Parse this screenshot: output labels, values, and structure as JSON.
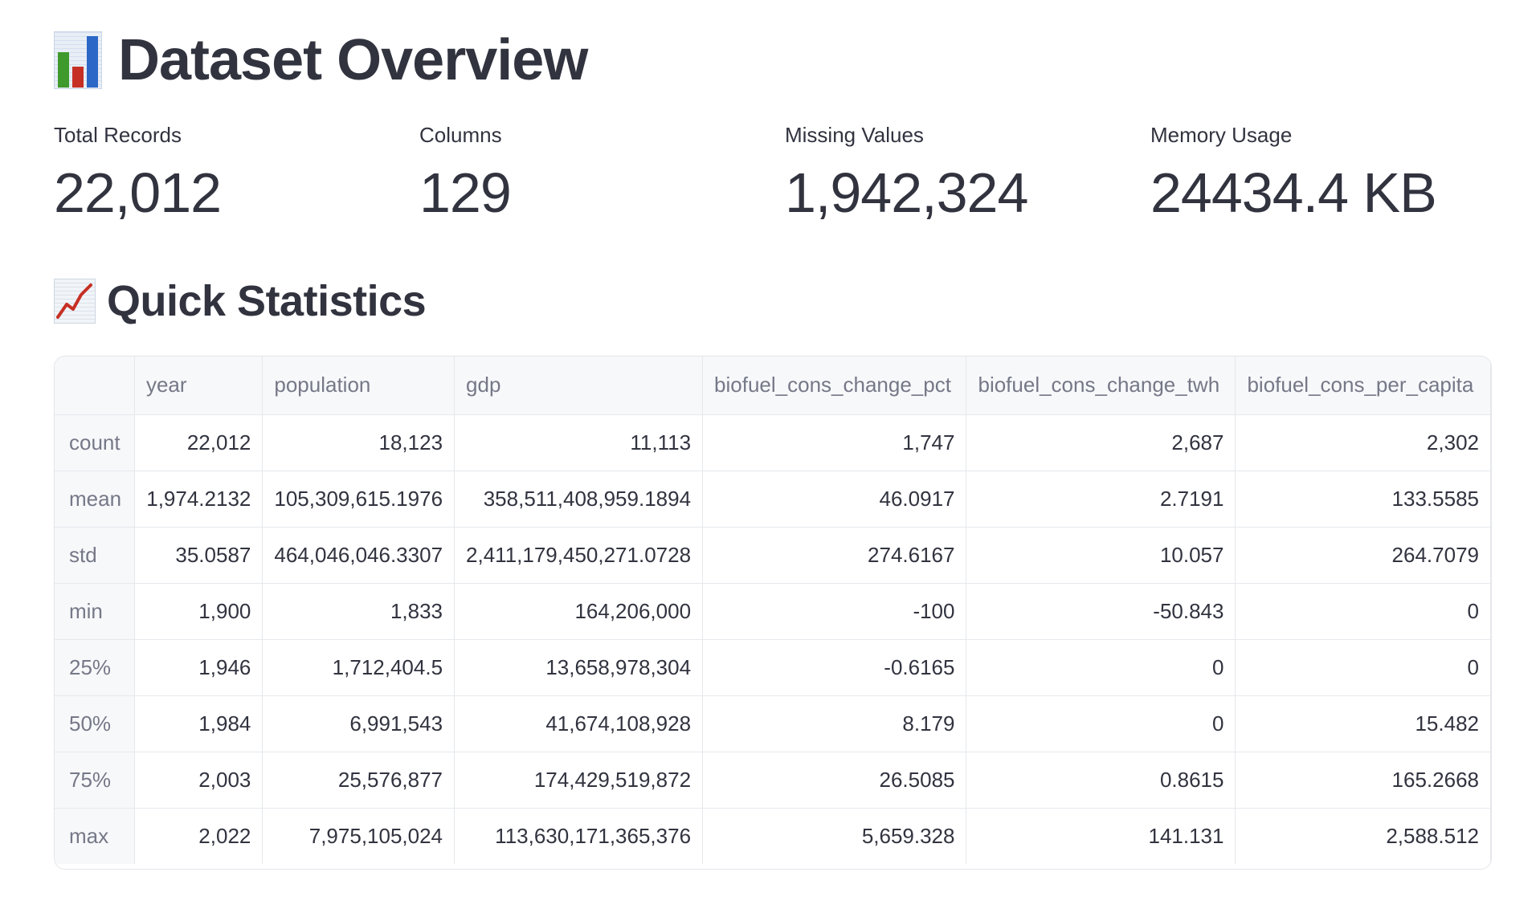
{
  "overview": {
    "icon": "bar-chart-icon",
    "title": "Dataset Overview"
  },
  "metrics": [
    {
      "label": "Total Records",
      "value": "22,012"
    },
    {
      "label": "Columns",
      "value": "129"
    },
    {
      "label": "Missing Values",
      "value": "1,942,324"
    },
    {
      "label": "Memory Usage",
      "value": "24434.4 KB"
    }
  ],
  "stats": {
    "icon": "line-chart-icon",
    "title": "Quick Statistics",
    "columns": [
      "",
      "year",
      "population",
      "gdp",
      "biofuel_cons_change_pct",
      "biofuel_cons_change_twh",
      "biofuel_cons_per_capita"
    ],
    "rows": [
      {
        "label": "count",
        "values": [
          "22,012",
          "18,123",
          "11,113",
          "1,747",
          "2,687",
          "2,302"
        ]
      },
      {
        "label": "mean",
        "values": [
          "1,974.2132",
          "105,309,615.1976",
          "358,511,408,959.1894",
          "46.0917",
          "2.7191",
          "133.5585"
        ]
      },
      {
        "label": "std",
        "values": [
          "35.0587",
          "464,046,046.3307",
          "2,411,179,450,271.0728",
          "274.6167",
          "10.057",
          "264.7079"
        ]
      },
      {
        "label": "min",
        "values": [
          "1,900",
          "1,833",
          "164,206,000",
          "-100",
          "-50.843",
          "0"
        ]
      },
      {
        "label": "25%",
        "values": [
          "1,946",
          "1,712,404.5",
          "13,658,978,304",
          "-0.6165",
          "0",
          "0"
        ]
      },
      {
        "label": "50%",
        "values": [
          "1,984",
          "6,991,543",
          "41,674,108,928",
          "8.179",
          "0",
          "15.482"
        ]
      },
      {
        "label": "75%",
        "values": [
          "2,003",
          "25,576,877",
          "174,429,519,872",
          "26.5085",
          "0.8615",
          "165.2668"
        ]
      },
      {
        "label": "max",
        "values": [
          "2,022",
          "7,975,105,024",
          "113,630,171,365,376",
          "5,659.328",
          "141.131",
          "2,588.512"
        ]
      }
    ]
  },
  "colors": {
    "text": "#31333f",
    "muted": "#757887",
    "header_bg": "#f7f8fa",
    "border": "#e6e8ec",
    "trend_line": "#c62f24"
  }
}
